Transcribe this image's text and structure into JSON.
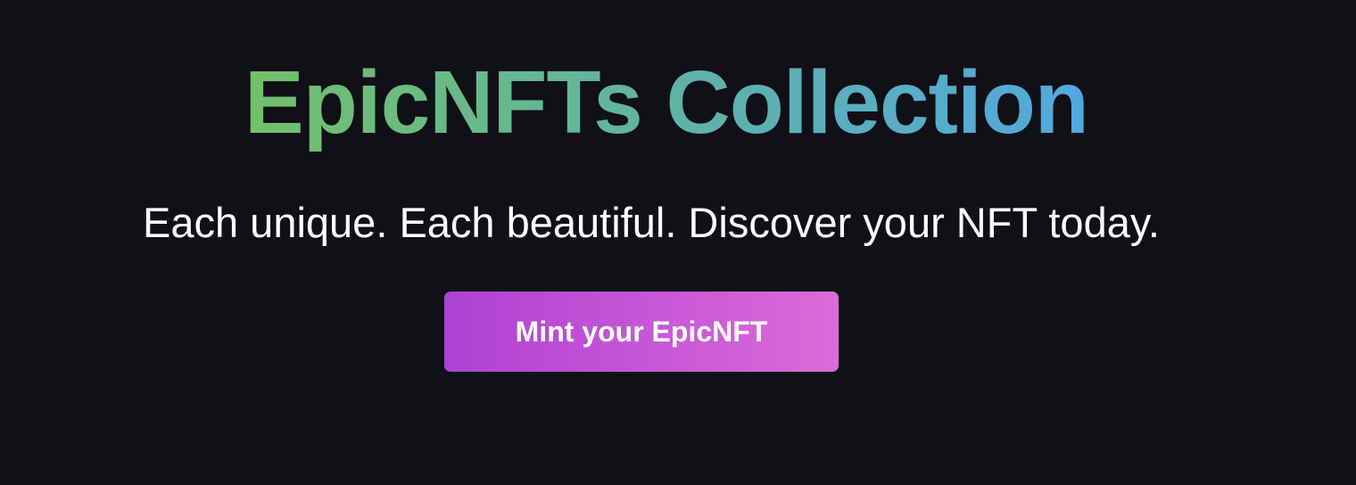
{
  "hero": {
    "title": "EpicNFTs Collection",
    "subtitle": "Each unique. Each beautiful. Discover your NFT today.",
    "cta_label": "Mint your EpicNFT"
  },
  "colors": {
    "background": "#0f1117",
    "title_gradient_start": "#73c06a",
    "title_gradient_end": "#52a8e0",
    "button_gradient_start": "#ae41d3",
    "button_gradient_end": "#dc6ad9",
    "text": "#ffffff"
  }
}
